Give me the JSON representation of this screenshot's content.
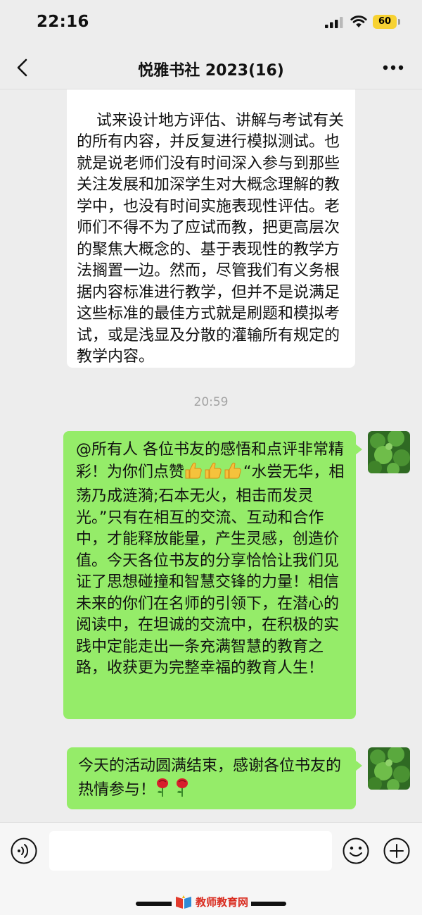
{
  "status_bar": {
    "time": "22:16",
    "battery": "60",
    "icons": [
      "signal-icon",
      "wifi-icon",
      "battery-icon"
    ],
    "battery_color": "#f7d233"
  },
  "header": {
    "title": "悦雅书社 2023(16)",
    "icons": [
      "back-chevron-icon",
      "more-options-icon"
    ]
  },
  "messages": [
    {
      "direction": "incoming",
      "text": "试来设计地方评估、讲解与考试有关的所有内容，并反复进行模拟测试。也就是说老师们没有时间深入参与到那些关注发展和加深学生对大概念理解的教学中，也没有时间实施表现性评估。老师们不得不为了应试而教，把更高层次的聚焦大概念的、基于表现性的教学方法搁置一边。然而，尽管我们有义务根据内容标准进行教学，但并不是说满足这些标准的最佳方式就是刷题和模拟考试，或是浅显及分散的灌输所有规定的教学内容。"
    },
    {
      "type": "timestamp",
      "text": "20:59"
    },
    {
      "direction": "outgoing",
      "text_part1": "@所有人 各位书友的感悟和点评非常精彩！为你们点赞",
      "emoji": "thumbs-up ×3",
      "text_part2": "“水尝无华，相荡乃成涟漪;石本无火，相击而发灵光。”只有在相互的交流、互动和合作中，才能释放能量，产生灵感，创造价值。今天各位书友的分享恰恰让我们见证了思想碰撞和智慧交锋的力量！相信未来的你们在名师的引领下，在潜心的阅读中，在坦诚的交流中，在积极的实践中定能走出一条充满智慧的教育之路，收获更为完整幸福的教育人生！"
    },
    {
      "direction": "outgoing",
      "text": "今天的活动圆满结束，感谢各位书友的热情参与！",
      "emoji": "rose ×2"
    }
  ],
  "input_bar": {
    "message_value": "",
    "icons": [
      "voice-icon",
      "emoji-icon",
      "plus-icon"
    ]
  },
  "watermark": {
    "text": "教师教育网"
  },
  "colors": {
    "background": "#ededed",
    "incoming_bubble": "#ffffff",
    "outgoing_bubble": "#95ec69",
    "timestamp": "#a3a3a3"
  }
}
